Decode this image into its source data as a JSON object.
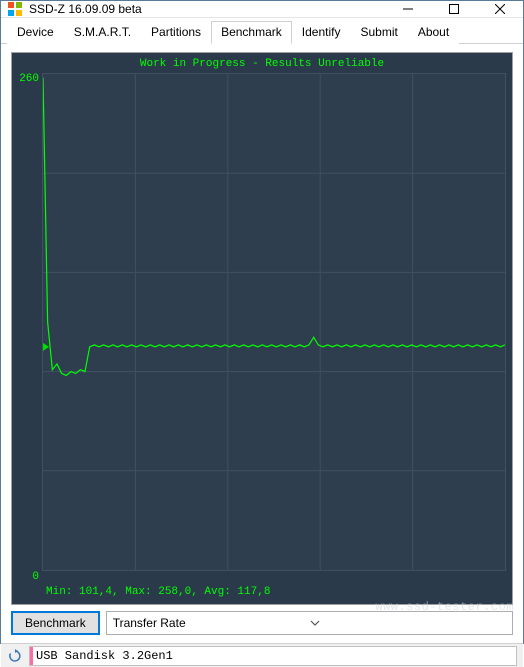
{
  "window": {
    "title": "SSD-Z 16.09.09 beta"
  },
  "tabs": [
    {
      "label": "Device"
    },
    {
      "label": "S.M.A.R.T."
    },
    {
      "label": "Partitions"
    },
    {
      "label": "Benchmark"
    },
    {
      "label": "Identify"
    },
    {
      "label": "Submit"
    },
    {
      "label": "About"
    }
  ],
  "activeTab": 3,
  "chart": {
    "header": "Work in Progress - Results Unreliable",
    "ymax": "260",
    "ymin": "0",
    "footer": "Min: 101,4, Max: 258,0, Avg: 117,8"
  },
  "controls": {
    "benchmarkButton": "Benchmark",
    "dropdownValue": "Transfer Rate"
  },
  "status": {
    "device": "USB Sandisk 3.2Gen1"
  },
  "watermark": "www.ssd-tester.com",
  "chart_data": {
    "type": "line",
    "title": "Work in Progress - Results Unreliable",
    "xlabel": "",
    "ylabel": "Transfer Rate",
    "ylim": [
      0,
      260
    ],
    "stats": {
      "min": 101.4,
      "max": 258.0,
      "avg": 117.8
    },
    "series": [
      {
        "name": "Transfer Rate",
        "x_range": [
          0,
          100
        ],
        "values": [
          258,
          130,
          105,
          108,
          103,
          102,
          104,
          103,
          105,
          104,
          117,
          118,
          117,
          118,
          117,
          118,
          117,
          118,
          117,
          118,
          117,
          118,
          117,
          118,
          117,
          118,
          117,
          118,
          117,
          118,
          117,
          118,
          117,
          118,
          117,
          118,
          117,
          118,
          117,
          118,
          117,
          118,
          117,
          118,
          117,
          118,
          117,
          118,
          117,
          118,
          117,
          118,
          117,
          118,
          117,
          118,
          117,
          118,
          122,
          118,
          117,
          118,
          117,
          118,
          117,
          118,
          117,
          118,
          117,
          118,
          117,
          118,
          117,
          118,
          117,
          118,
          117,
          118,
          117,
          118,
          117,
          118,
          117,
          118,
          117,
          118,
          117,
          118,
          117,
          118,
          117,
          118,
          117,
          118,
          117,
          118,
          117,
          118,
          117,
          118
        ]
      }
    ]
  }
}
